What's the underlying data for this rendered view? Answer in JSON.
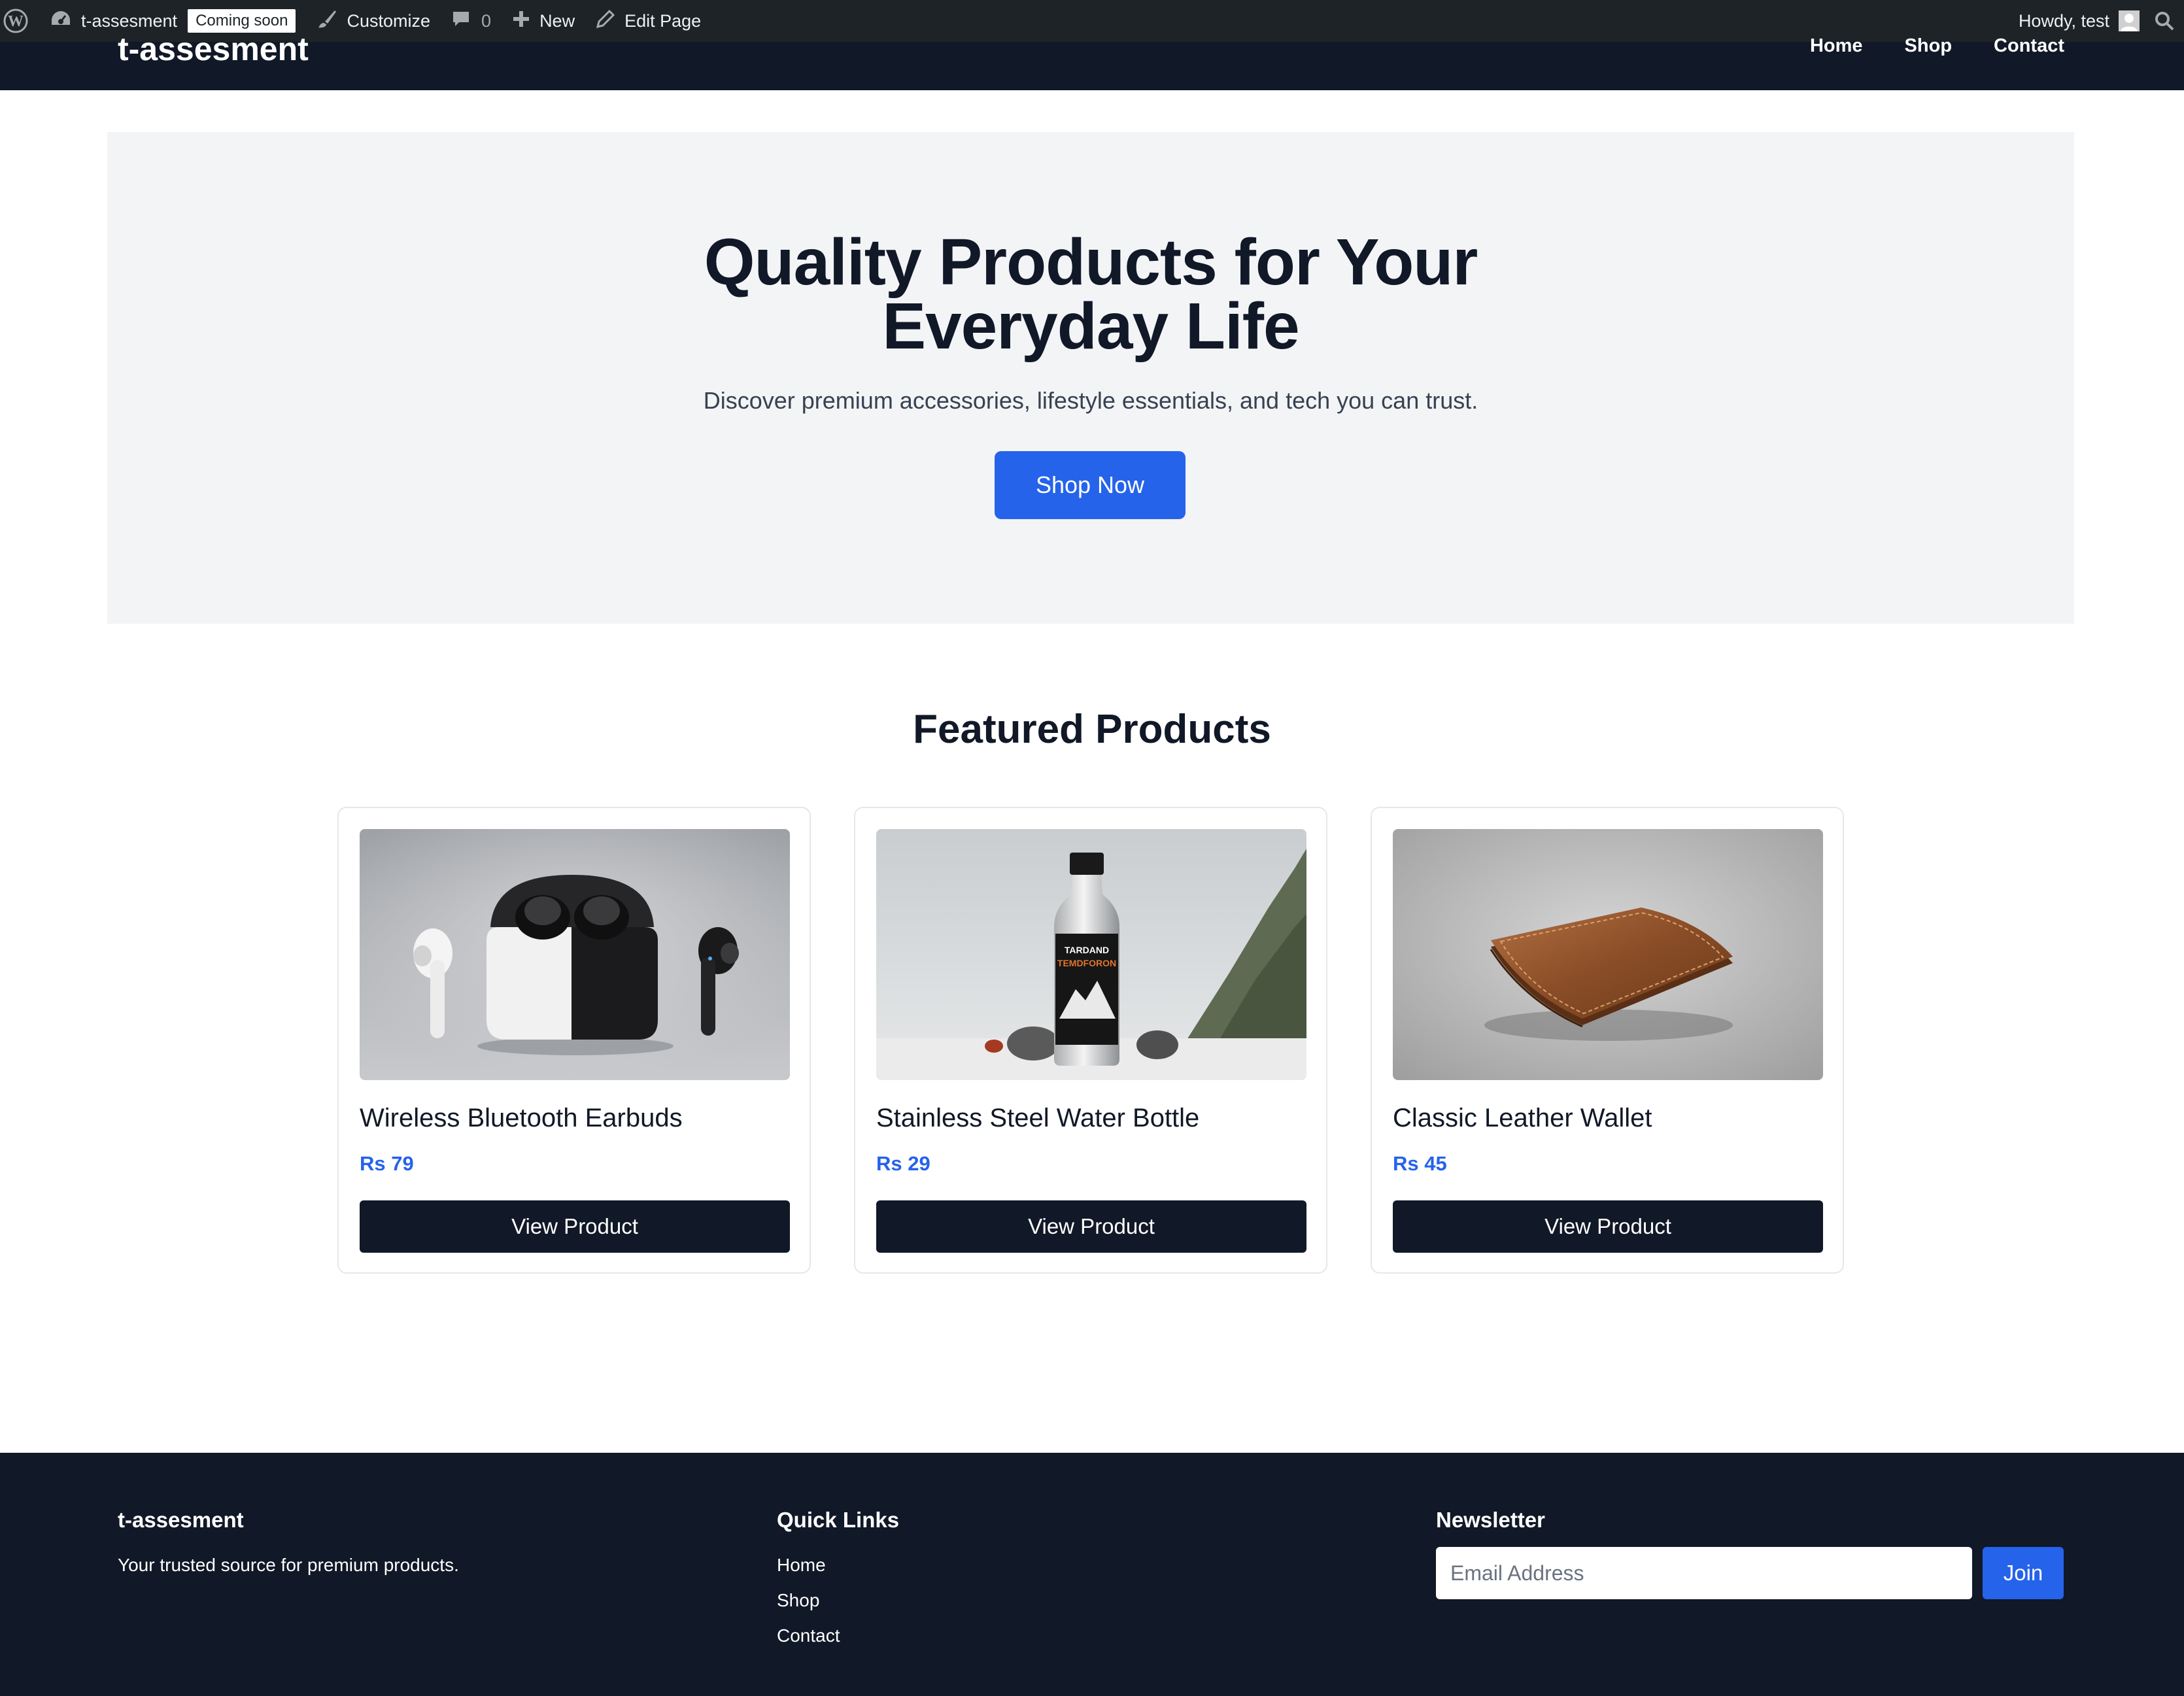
{
  "admin_bar": {
    "site_name": "t-assesment",
    "coming_soon_badge": "Coming soon",
    "customize": "Customize",
    "comments_count": "0",
    "new": "New",
    "edit_page": "Edit Page",
    "greeting": "Howdy, test"
  },
  "header": {
    "site_title": "t-assesment",
    "nav": [
      "Home",
      "Shop",
      "Contact"
    ]
  },
  "hero": {
    "title": "Quality Products for Your Everyday Life",
    "subtitle": "Discover premium accessories, lifestyle essentials, and tech you can trust.",
    "cta": "Shop Now",
    "background_color": "#f3f4f6",
    "cta_color": "#2563eb"
  },
  "featured": {
    "title": "Featured Products",
    "products": [
      {
        "name": "Wireless Bluetooth Earbuds",
        "price": "Rs 79",
        "button": "View Product"
      },
      {
        "name": "Stainless Steel Water Bottle",
        "price": "Rs 29",
        "button": "View Product"
      },
      {
        "name": "Classic Leather Wallet",
        "price": "Rs 45",
        "button": "View Product"
      }
    ],
    "bottle_label_line1": "TARDAND",
    "bottle_label_line2": "TEMDFORON"
  },
  "footer": {
    "brand": "t-assesment",
    "tagline": "Your trusted source for premium products.",
    "quick_links_title": "Quick Links",
    "quick_links": [
      "Home",
      "Shop",
      "Contact"
    ],
    "newsletter_title": "Newsletter",
    "email_placeholder": "Email Address",
    "join": "Join"
  },
  "colors": {
    "dark": "#111827",
    "accent": "#2563eb",
    "admin_bar": "#1d2327"
  }
}
